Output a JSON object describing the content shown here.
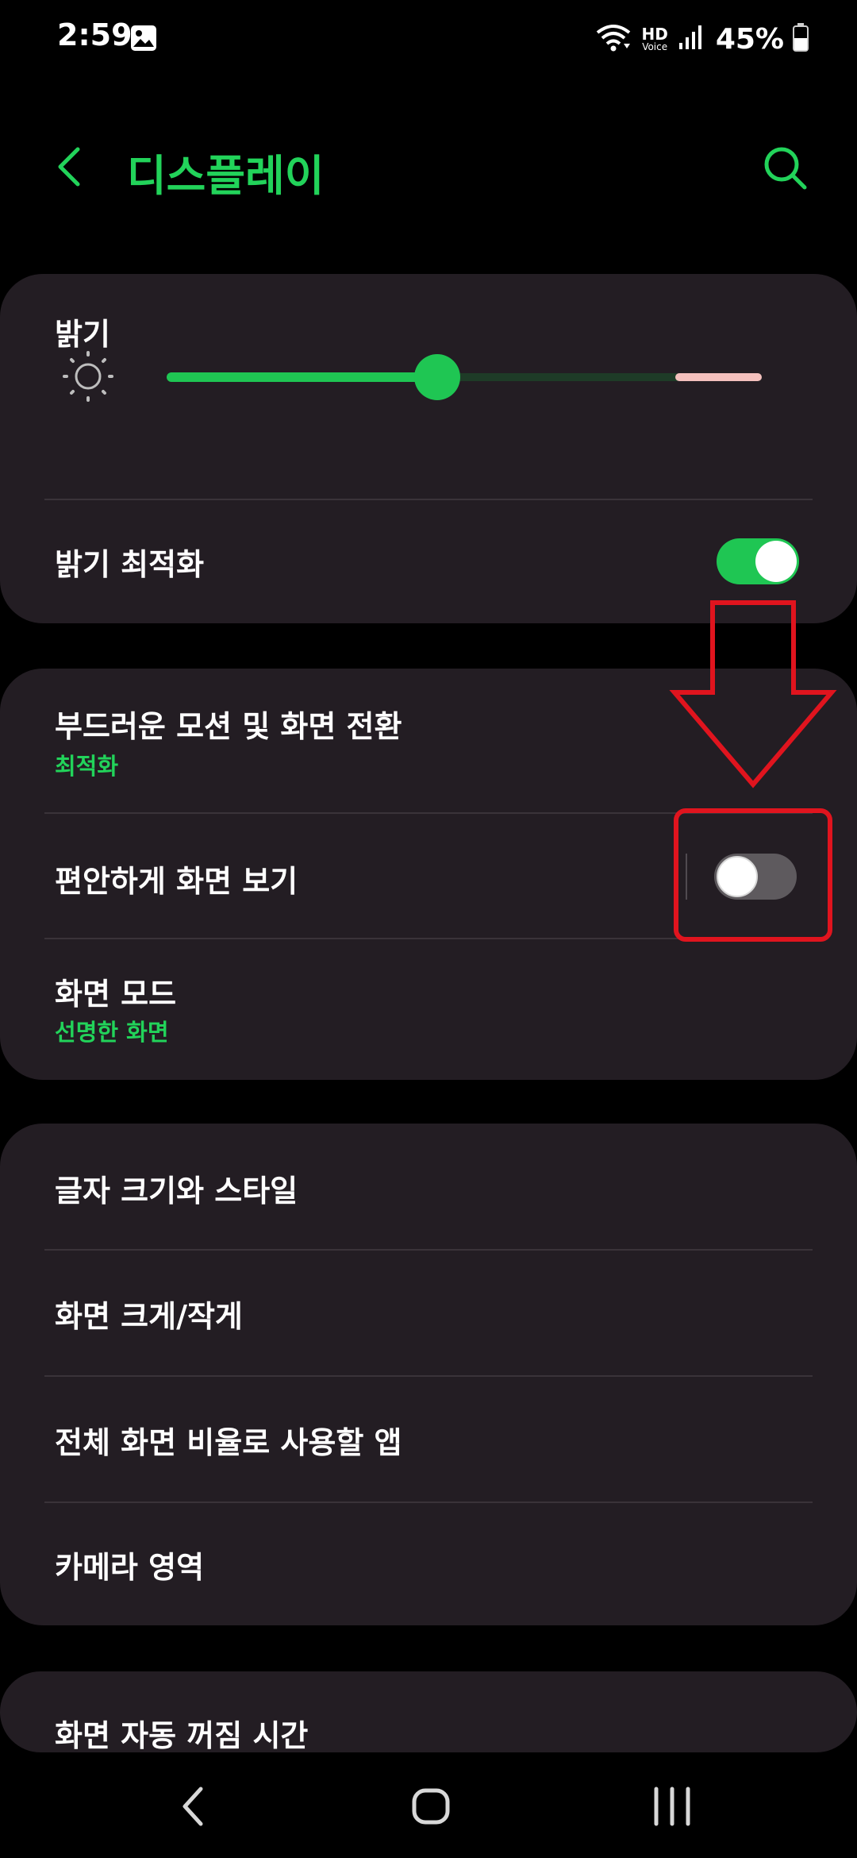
{
  "status_bar": {
    "time": "2:59",
    "hd_label": "HD",
    "voice_label": "Voice",
    "battery": "45%",
    "icons": [
      "gallery-icon",
      "wifi-icon",
      "signal-icon",
      "battery-icon"
    ]
  },
  "header": {
    "title": "디스플레이",
    "back_icon": "chevron-left-icon",
    "search_icon": "search-icon"
  },
  "brightness_card": {
    "title": "밝기",
    "slider_value": 0.455,
    "slider_extra_start": 0.855,
    "adaptive_label": "밝기 최적화",
    "adaptive_on": true
  },
  "motion_card": {
    "smooth_title": "부드러운 모션 및 화면 전환",
    "smooth_sub": "최적화",
    "comfort_title": "편안하게 화면 보기",
    "comfort_on": false,
    "mode_title": "화면 모드",
    "mode_sub": "선명한 화면"
  },
  "text_card": {
    "items": [
      "글자 크기와 스타일",
      "화면 크게/작게",
      "전체 화면 비율로 사용할 앱",
      "카메라 영역"
    ]
  },
  "timeout_card": {
    "title": "화면 자동 꺼짐 시간"
  },
  "colors": {
    "accent": "#22d35a",
    "card": "#231d23",
    "annotation": "#e0141e"
  },
  "nav": {
    "back_icon": "nav-back-icon",
    "home_icon": "nav-home-icon",
    "recents_icon": "nav-recents-icon"
  }
}
